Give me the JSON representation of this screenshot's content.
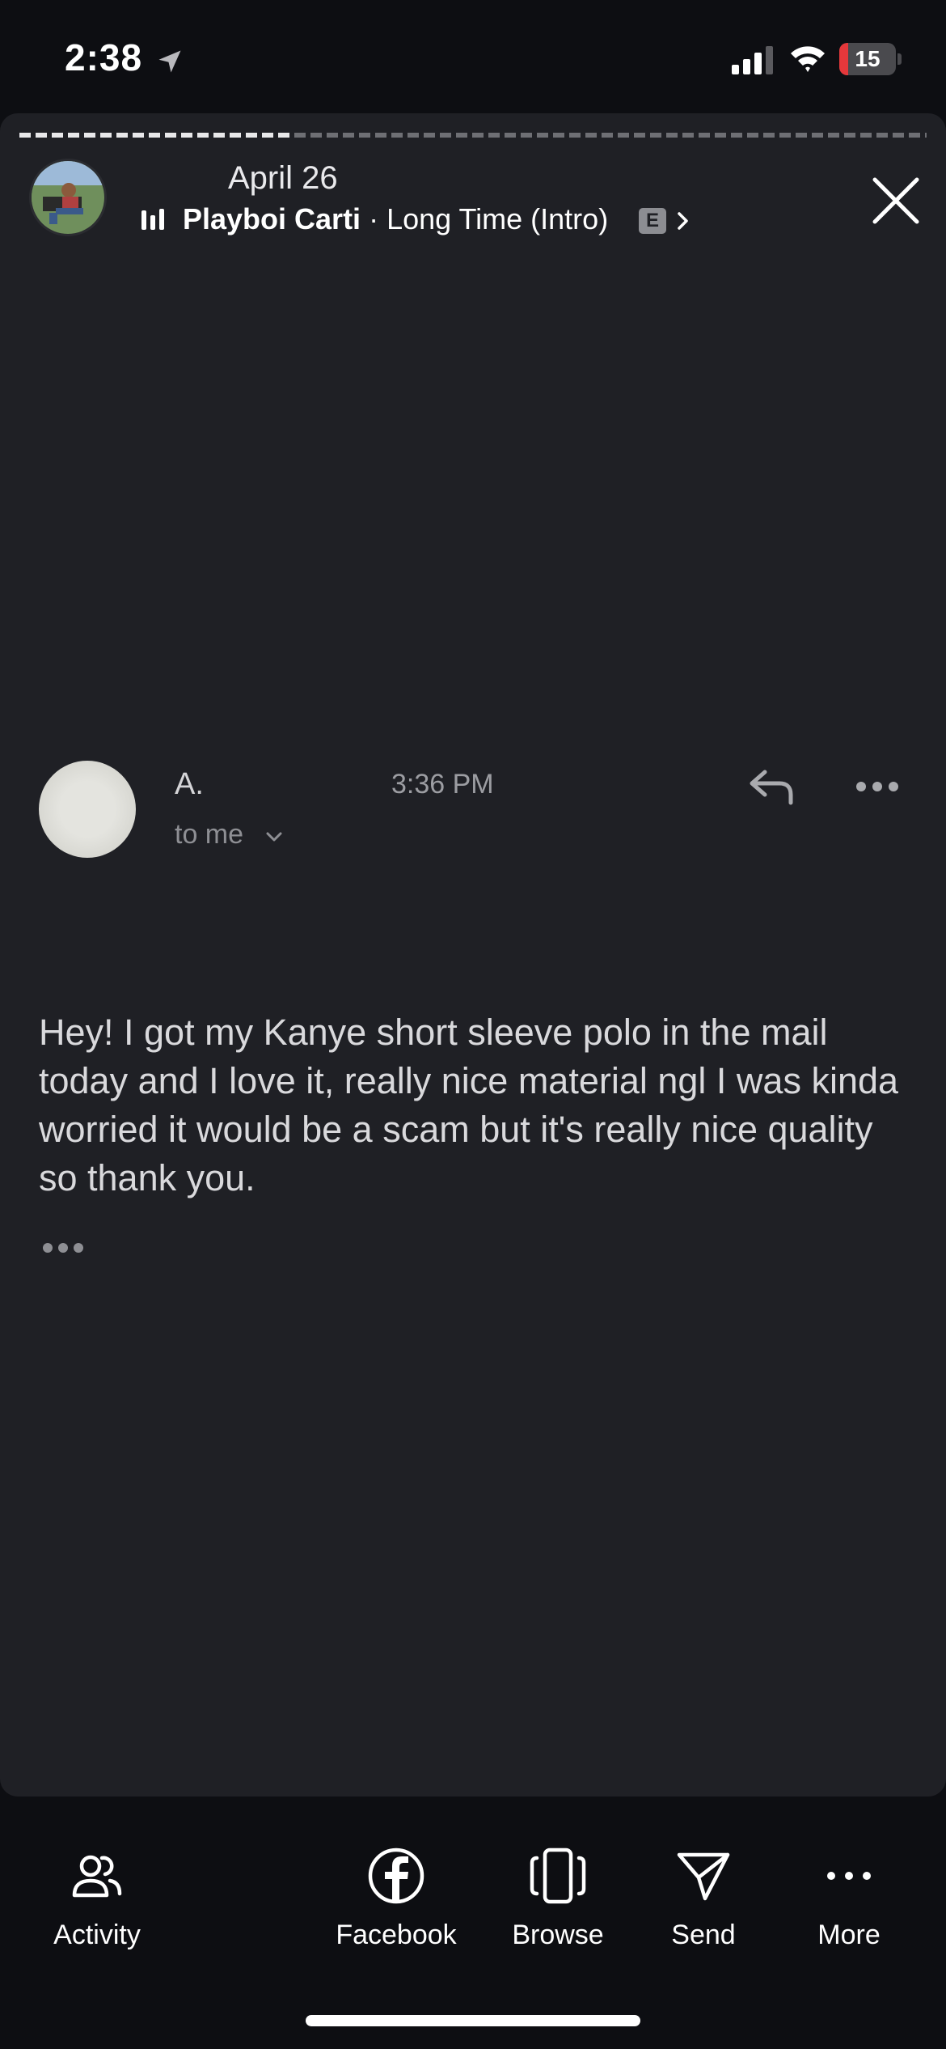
{
  "status_bar": {
    "time": "2:38",
    "battery_level": "15",
    "battery_fraction": 0.15,
    "battery_color": "#e5383b"
  },
  "story": {
    "date": "April 26",
    "music": {
      "artist": "Playboi Carti",
      "separator": " · ",
      "title": "Long Time (Intro)",
      "explicit_badge": "E"
    },
    "progress_fraction": 0.3
  },
  "email": {
    "sender_name": "A.",
    "time": "3:36 PM",
    "recipient": "to me",
    "body": "Hey! I got my Kanye short sleeve polo in the mail today and I love it, really nice material ngl I was kinda worried it would be a scam but it's really nice quality so thank you."
  },
  "bottom_nav": {
    "items": [
      {
        "label": "Activity",
        "icon": "people-icon"
      },
      {
        "label": "Facebook",
        "icon": "facebook-icon"
      },
      {
        "label": "Browse",
        "icon": "browse-icon"
      },
      {
        "label": "Send",
        "icon": "send-icon"
      },
      {
        "label": "More",
        "icon": "more-icon"
      }
    ]
  },
  "colors": {
    "background": "#0d0e12",
    "card": "#1f2025",
    "text_primary": "#ffffff",
    "text_secondary": "#8e8f94"
  }
}
